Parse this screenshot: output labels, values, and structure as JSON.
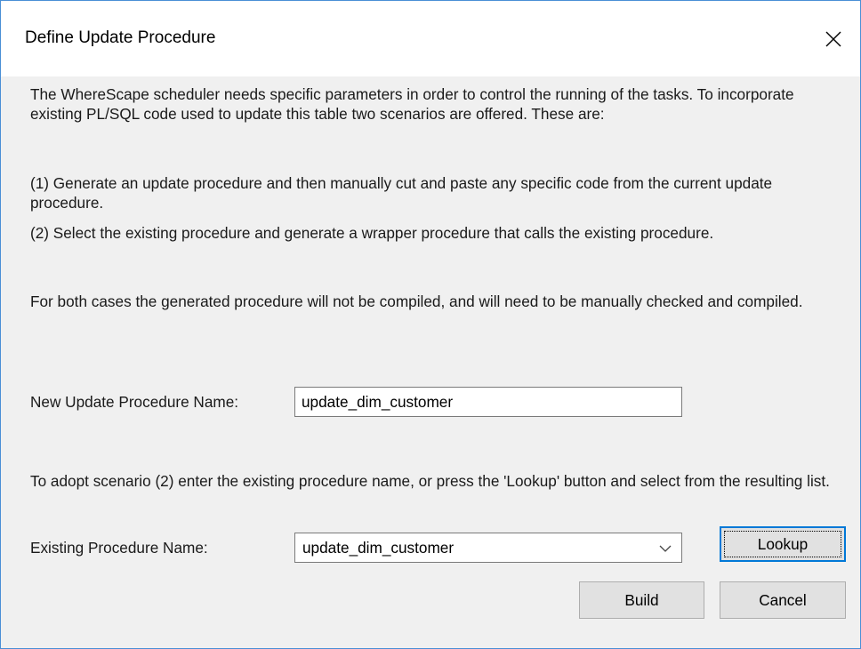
{
  "window": {
    "title": "Define Update Procedure"
  },
  "intro": {
    "line1": "The WhereScape scheduler needs specific parameters in order to control the running of the tasks. To incorporate existing PL/SQL code used to update this table two scenarios are offered. These are:",
    "scenario1": "(1) Generate an update procedure and then manually cut and paste any specific code from the current update procedure.",
    "scenario2": "(2) Select the existing procedure and generate a wrapper procedure that calls the existing procedure.",
    "note": "For both cases the generated procedure will not be compiled, and will need to be manually checked and compiled."
  },
  "new_procedure": {
    "label": "New Update Procedure Name:",
    "value": "update_dim_customer"
  },
  "adopt": {
    "instructions": "To adopt scenario (2) enter the existing procedure name, or press the 'Lookup' button and select from the resulting list."
  },
  "existing_procedure": {
    "label": "Existing Procedure Name:",
    "value": "update_dim_customer"
  },
  "buttons": {
    "lookup": "Lookup",
    "build": "Build",
    "cancel": "Cancel"
  },
  "colors": {
    "window_border": "#4a8fd6",
    "focus_blue": "#0078d7",
    "dialog_bg": "#f0f0f0",
    "button_bg": "#e1e1e1"
  },
  "icons": {
    "close": "close-icon",
    "dropdown": "chevron-down-icon"
  }
}
